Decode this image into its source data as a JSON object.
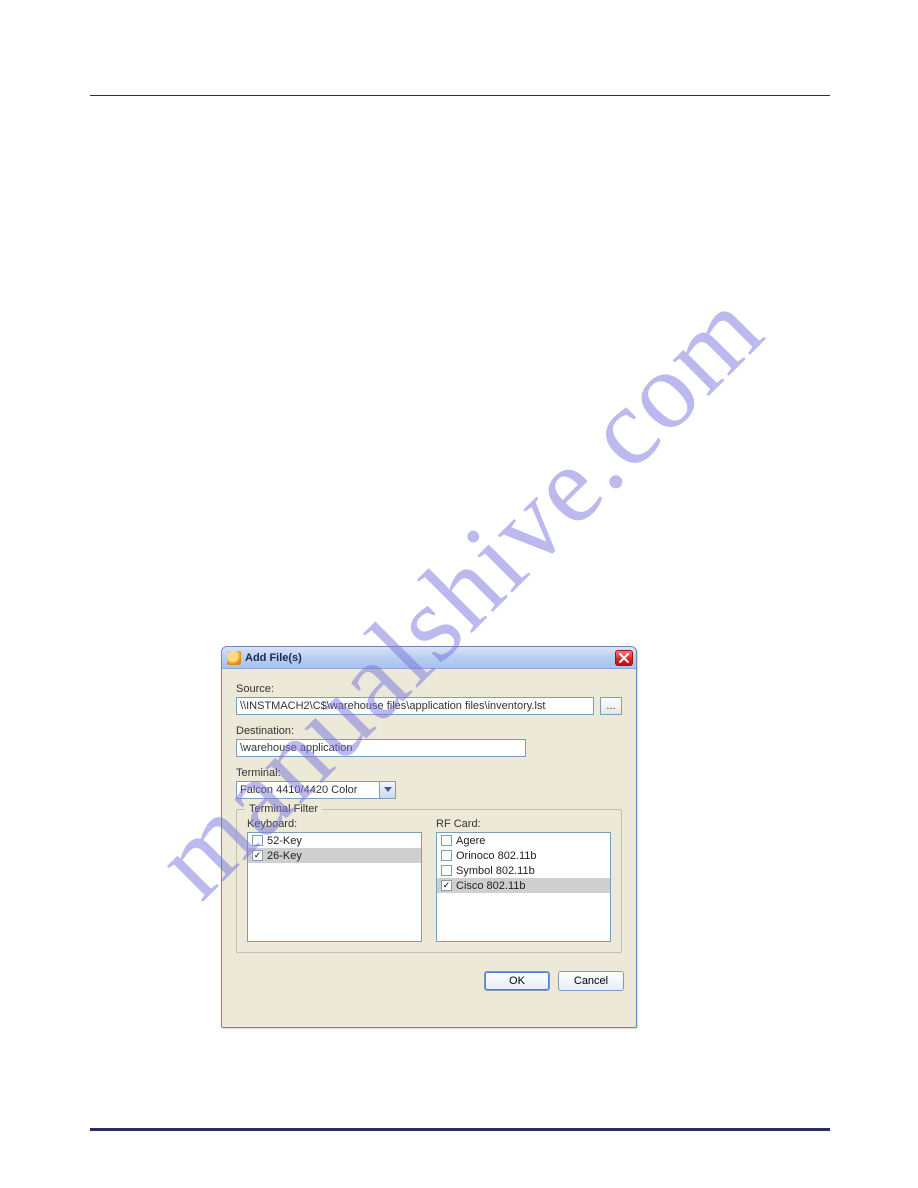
{
  "watermark": "manualshive.com",
  "dialog": {
    "title": "Add File(s)",
    "source": {
      "label": "Source:",
      "value": "\\\\INSTMACH2\\C$\\warehouse files\\application files\\inventory.lst",
      "browse_label": "..."
    },
    "destination": {
      "label": "Destination:",
      "value": "\\warehouse application"
    },
    "terminal": {
      "label": "Terminal:",
      "value": "Falcon 4410/4420 Color"
    },
    "filter": {
      "legend": "Terminal Filter",
      "keyboard": {
        "label": "Keyboard:",
        "items": [
          {
            "label": "52-Key",
            "checked": false,
            "selected": false
          },
          {
            "label": "26-Key",
            "checked": true,
            "selected": true
          }
        ]
      },
      "rf": {
        "label": "RF Card:",
        "items": [
          {
            "label": "Agere",
            "checked": false,
            "selected": false
          },
          {
            "label": "Orinoco 802.11b",
            "checked": false,
            "selected": false
          },
          {
            "label": "Symbol 802.11b",
            "checked": false,
            "selected": false
          },
          {
            "label": "Cisco 802.11b",
            "checked": true,
            "selected": true
          }
        ]
      }
    },
    "buttons": {
      "ok": "OK",
      "cancel": "Cancel"
    }
  }
}
